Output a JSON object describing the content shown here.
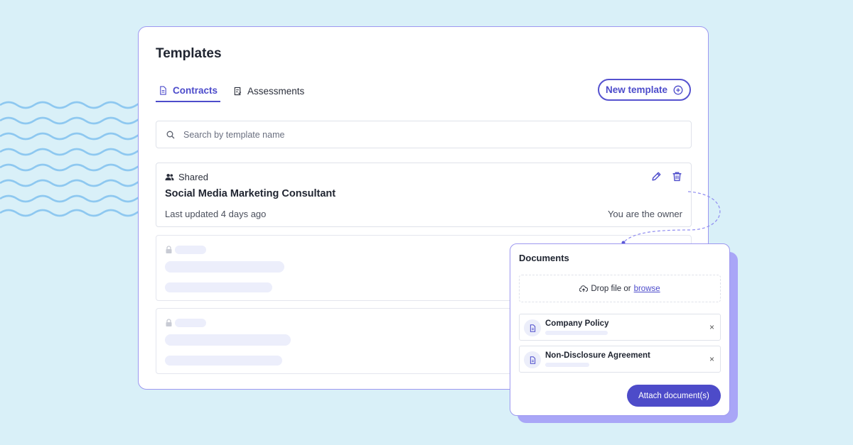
{
  "templates": {
    "title": "Templates",
    "tabs": [
      {
        "label": "Contracts",
        "icon": "document-icon",
        "active": true
      },
      {
        "label": "Assessments",
        "icon": "checklist-icon",
        "active": false
      }
    ],
    "new_template_label": "New template",
    "search_placeholder": "Search by template name",
    "items": [
      {
        "visibility": "Shared",
        "name": "Social Media Marketing Consultant",
        "updated": "Last updated 4 days ago",
        "owner": "You are the owner"
      }
    ]
  },
  "documents": {
    "title": "Documents",
    "drop_text": "Drop file or",
    "browse_label": "browse",
    "files": [
      {
        "name": "Company Policy"
      },
      {
        "name": "Non-Disclosure Agreement"
      }
    ],
    "close_glyph": "×",
    "attach_label": "Attach document(s)"
  },
  "colors": {
    "background": "#d9f0f8",
    "accent": "#4d4ccb",
    "border_accent": "#9d98f0",
    "panel_shadow": "#a9a6f7",
    "wave": "#8ec8f0"
  }
}
